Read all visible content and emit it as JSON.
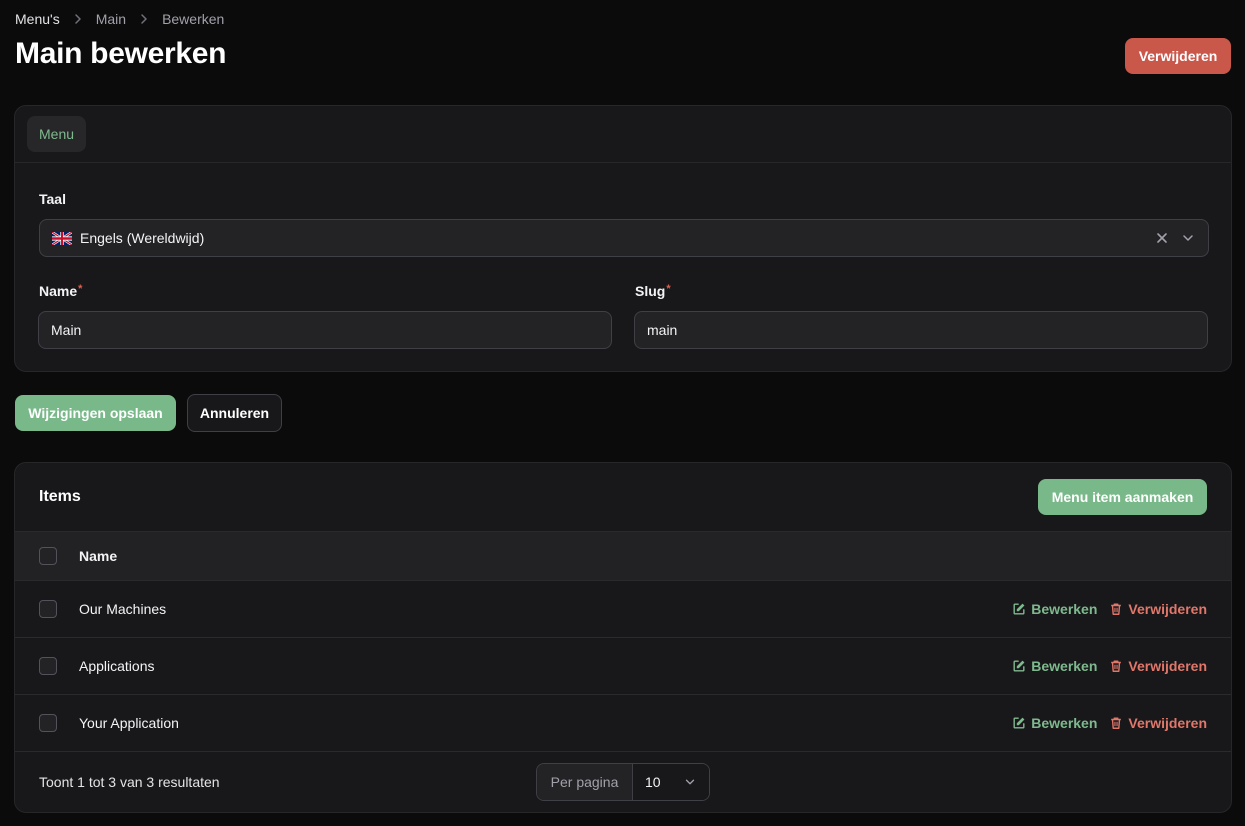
{
  "breadcrumb": [
    "Menu's",
    "Main",
    "Bewerken"
  ],
  "page": {
    "title": "Main bewerken",
    "delete_label": "Verwijderen"
  },
  "form": {
    "tab_label": "Menu",
    "language": {
      "label": "Taal",
      "value": "Engels (Wereldwijd)",
      "flag_icon": "uk-flag-icon"
    },
    "name": {
      "label": "Name",
      "required_mark": "*",
      "value": "Main"
    },
    "slug": {
      "label": "Slug",
      "required_mark": "*",
      "value": "main"
    }
  },
  "form_actions": {
    "save_label": "Wijzigingen opslaan",
    "cancel_label": "Annuleren"
  },
  "items_table": {
    "title": "Items",
    "create_label": "Menu item aanmaken",
    "column_name": "Name",
    "rows": [
      {
        "name": "Our Machines",
        "edit_label": "Bewerken",
        "delete_label": "Verwijderen"
      },
      {
        "name": "Applications",
        "edit_label": "Bewerken",
        "delete_label": "Verwijderen"
      },
      {
        "name": "Your Application",
        "edit_label": "Bewerken",
        "delete_label": "Verwijderen"
      }
    ],
    "results_text": "Toont 1 tot 3 van 3 resultaten",
    "per_page_label": "Per pagina",
    "per_page_value": "10"
  },
  "colors": {
    "background": "#0b0b0c",
    "card": "#18181b",
    "primary": "#79b889",
    "danger": "#c9574a",
    "edit_text": "#7fb98e",
    "delete_text": "#e0776a"
  }
}
